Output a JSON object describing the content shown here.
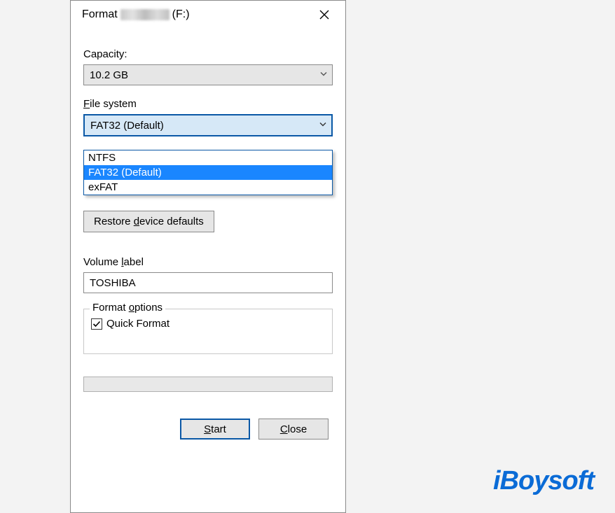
{
  "title": {
    "prefix": "Format",
    "suffix": "(F:)"
  },
  "capacity": {
    "label": "Capacity:",
    "value": "10.2 GB"
  },
  "filesystem": {
    "label_pre": "",
    "label_u": "F",
    "label_post": "ile system",
    "value": "FAT32 (Default)",
    "options": [
      "NTFS",
      "FAT32 (Default)",
      "exFAT"
    ],
    "selected_index": 1
  },
  "restore": {
    "label_pre": "Restore ",
    "label_u": "d",
    "label_post": "evice defaults"
  },
  "volume": {
    "label_pre": "Volume ",
    "label_u": "l",
    "label_post": "abel",
    "value": "TOSHIBA"
  },
  "format_options": {
    "legend_pre": "Format ",
    "legend_u": "o",
    "legend_post": "ptions",
    "quick_format_label": "Quick Format",
    "quick_format_checked": true
  },
  "actions": {
    "start_u": "S",
    "start_post": "tart",
    "close_u": "C",
    "close_post": "lose"
  },
  "watermark": "iBoysoft"
}
